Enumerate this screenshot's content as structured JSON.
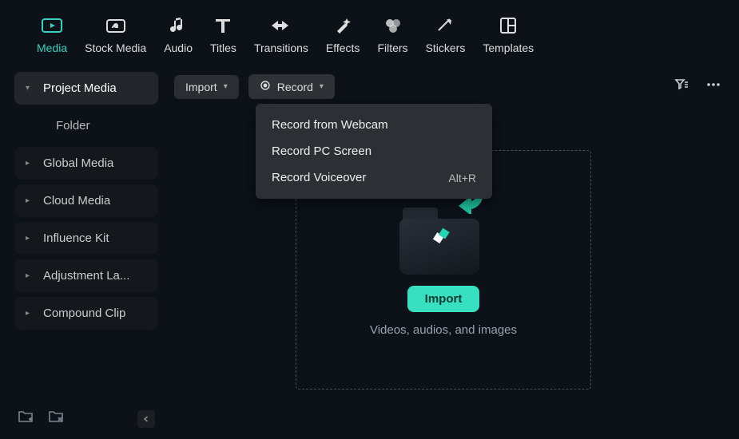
{
  "topTabs": {
    "media": "Media",
    "stockMedia": "Stock Media",
    "audio": "Audio",
    "titles": "Titles",
    "transitions": "Transitions",
    "effects": "Effects",
    "filters": "Filters",
    "stickers": "Stickers",
    "templates": "Templates"
  },
  "sidebar": {
    "projectMedia": "Project Media",
    "folder": "Folder",
    "globalMedia": "Global Media",
    "cloudMedia": "Cloud Media",
    "influenceKit": "Influence Kit",
    "adjustmentLayer": "Adjustment La...",
    "compoundClip": "Compound Clip"
  },
  "ctrl": {
    "import": "Import",
    "record": "Record"
  },
  "recordMenu": {
    "webcam": "Record from Webcam",
    "screen": "Record PC Screen",
    "voiceover": "Record Voiceover",
    "voiceoverShortcut": "Alt+R"
  },
  "dropzone": {
    "importBtn": "Import",
    "caption": "Videos, audios, and images"
  },
  "colors": {
    "accent": "#2fd3c0"
  }
}
